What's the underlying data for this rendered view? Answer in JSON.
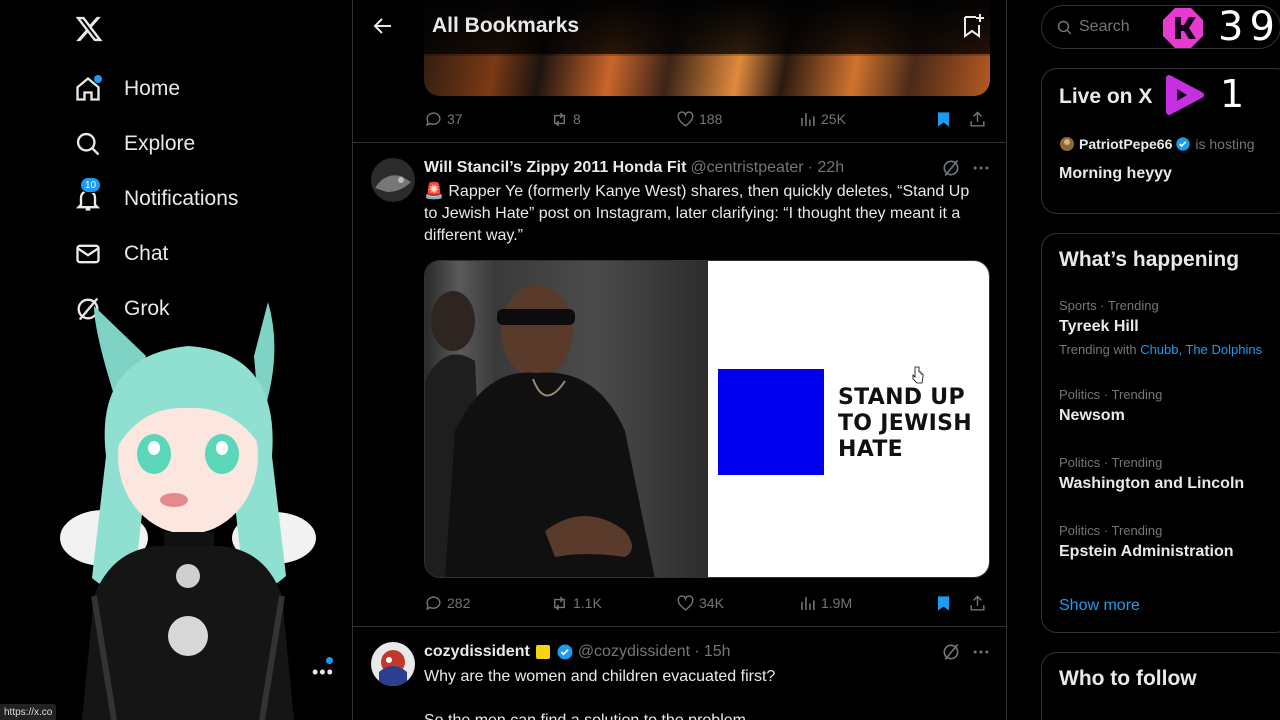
{
  "sidebar": {
    "items": [
      {
        "label": "Home"
      },
      {
        "label": "Explore"
      },
      {
        "label": "Notifications",
        "badge": "10"
      },
      {
        "label": "Chat"
      },
      {
        "label": "Grok"
      }
    ],
    "status_url": "https://x.co"
  },
  "header": {
    "title": "All Bookmarks"
  },
  "posts": [
    {
      "stats": {
        "replies": "37",
        "reposts": "8",
        "likes": "188",
        "views": "25K"
      }
    },
    {
      "author": "Will Stancil’s Zippy 2011 Honda Fit",
      "handle": "@centristpeater",
      "time": "· 22h",
      "text": "🚨 Rapper Ye (formerly Kanye West) shares, then quickly deletes, “Stand Up to Jewish Hate” post on Instagram, later clarifying: “I thought they meant it a different way.”",
      "image_text": "STAND UP TO JEWISH HATE",
      "stats": {
        "replies": "282",
        "reposts": "1.1K",
        "likes": "34K",
        "views": "1.9M"
      }
    },
    {
      "author": "cozydissident",
      "handle": "@cozydissident",
      "time": "· 15h",
      "text": "Why are the women and children evacuated first?",
      "text2": "So the men can find a solution to the problem."
    }
  ],
  "search": {
    "placeholder": "Search"
  },
  "overlay": {
    "kick_count": "39",
    "live_count": "1"
  },
  "live": {
    "title": "Live on X",
    "host": "PatriotPepe66",
    "hosting_label": "is hosting",
    "subtitle": "Morning heyyy"
  },
  "trends": {
    "title": "What’s happening",
    "items": [
      {
        "meta": "Sports · Trending",
        "topic": "Tyreek Hill",
        "with_label": "Trending with",
        "with_links": "Chubb, The Dolphins"
      },
      {
        "meta": "Politics · Trending",
        "topic": "Newsom"
      },
      {
        "meta": "Politics · Trending",
        "topic": "Washington and Lincoln"
      },
      {
        "meta": "Politics · Trending",
        "topic": "Epstein Administration"
      }
    ],
    "show_more": "Show more"
  },
  "follow": {
    "title": "Who to follow"
  },
  "colors": {
    "accent": "#1d9bf0",
    "background": "#000000",
    "border": "#2f3336",
    "muted": "#71767b"
  }
}
